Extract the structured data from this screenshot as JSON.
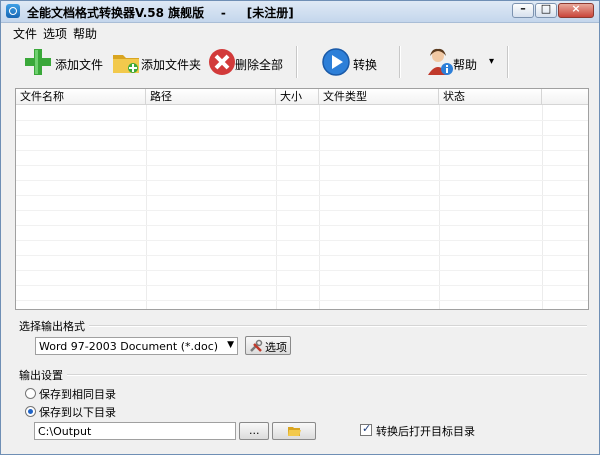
{
  "window": {
    "title": "全能文档格式转换器V.58 旗舰版    -     [未注册]"
  },
  "title_buttons": [
    {
      "name": "minimize",
      "glyph": "–"
    },
    {
      "name": "maximize",
      "glyph": "□"
    },
    {
      "name": "close",
      "glyph": "×"
    }
  ],
  "menu": [
    "文件",
    "选项",
    "帮助"
  ],
  "toolbar": {
    "add_file": "添加文件",
    "add_folder": "添加文件夹",
    "delete_all": "删除全部",
    "convert": "转换",
    "help": "帮助",
    "help_dropdown": "▾"
  },
  "file_list": {
    "columns": [
      "文件名称",
      "路径",
      "大小",
      "文件类型",
      "状态"
    ],
    "rows": []
  },
  "output_format": {
    "group_label": "选择输出格式",
    "selected": "Word 97-2003 Document (*.doc)",
    "options_button": "选项"
  },
  "output_settings": {
    "group_label": "输出设置",
    "radio_same_dir": "保存到相同目录",
    "radio_custom_dir": "保存到以下目录",
    "radio_custom_checked": true,
    "path": "C:\\Output",
    "browse_button": "...",
    "open_after_label": "转换后打开目标目录",
    "open_after_checked": true
  },
  "colors": {
    "title_gradient_top": "#dfe9f5",
    "title_gradient_bottom": "#c4d6ec",
    "accent_blue": "#1f63c6"
  }
}
